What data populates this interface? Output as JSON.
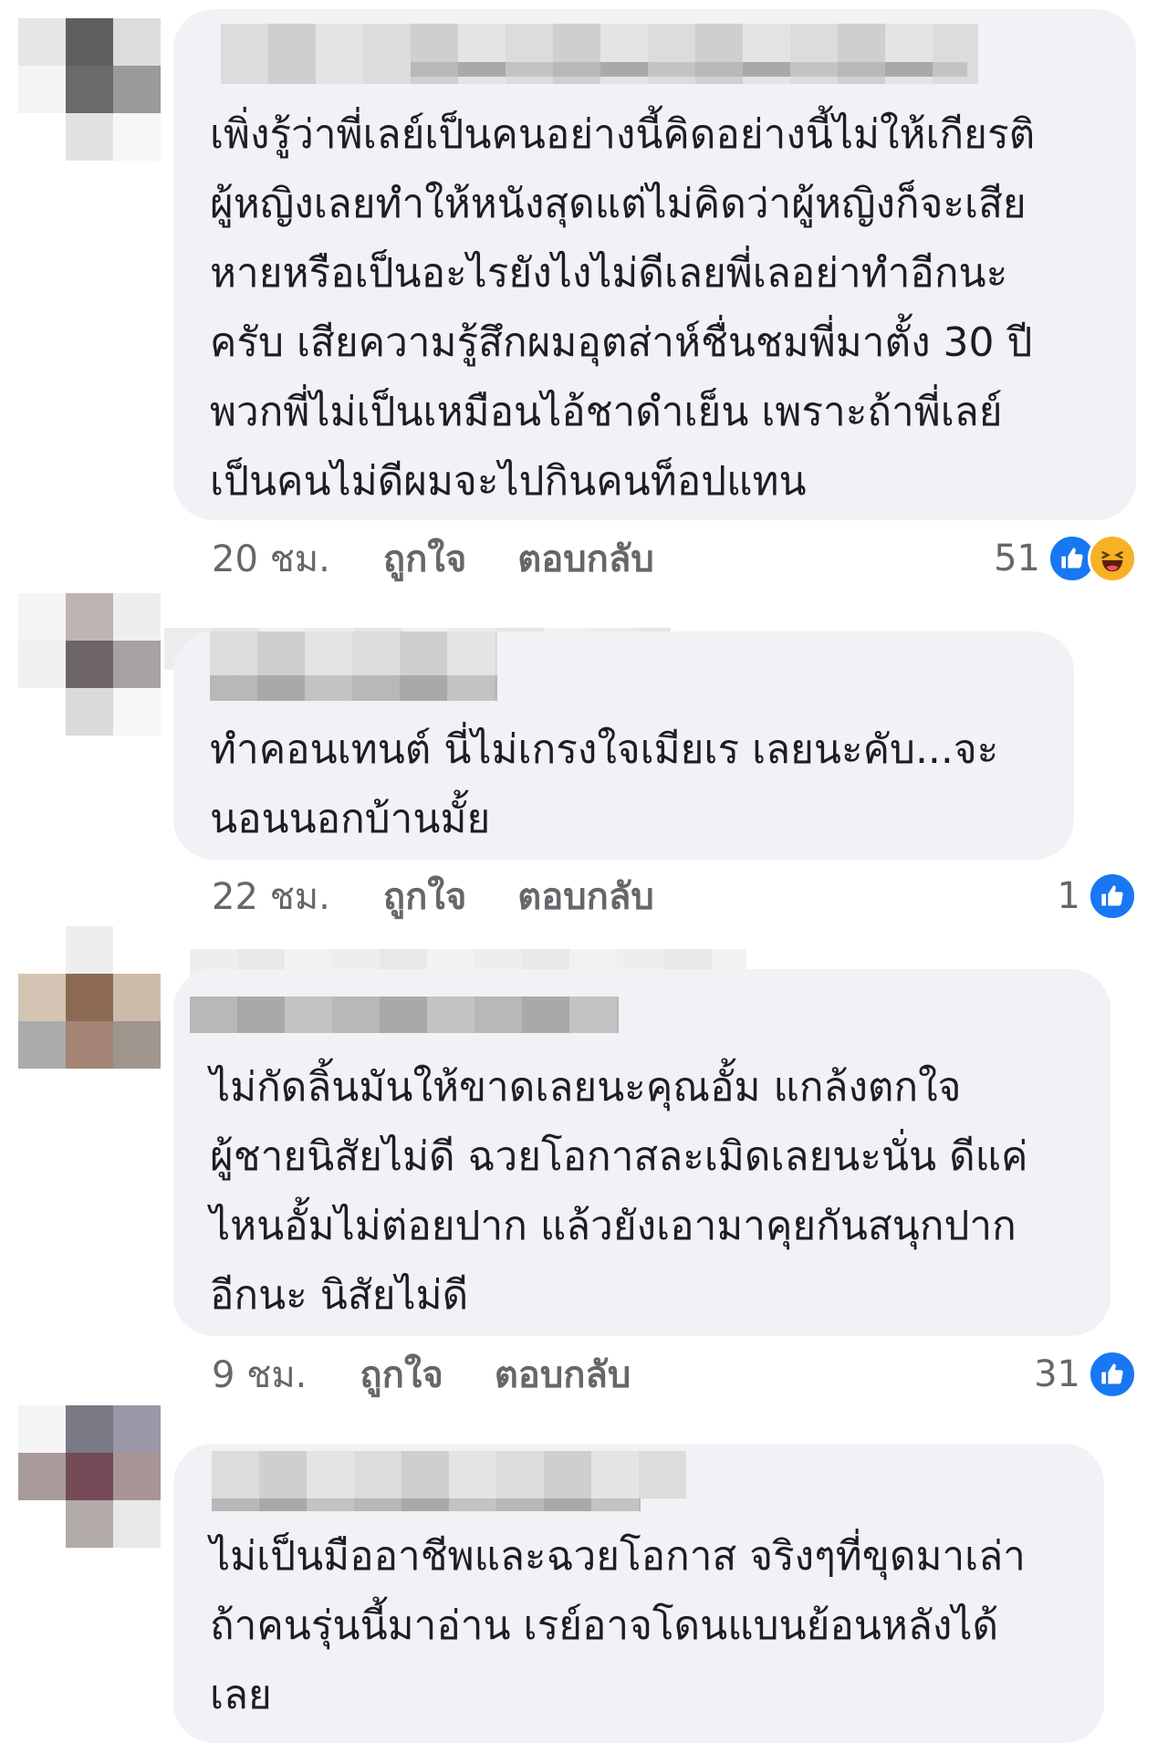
{
  "colors": {
    "bubble_bg": "#f0f2f5",
    "text": "#1c1e21",
    "meta": "#65676b",
    "like": "#1877f2",
    "haha": "#f7b125"
  },
  "comments": [
    {
      "text": "เพิ่งรู้ว่าพี่เลย์เป็นคนอย่างนี้คิดอย่างนี้ไม่ให้เกียรติ\nผู้หญิงเลยทำให้หนังสุดแต่ไม่คิดว่าผู้หญิงก็จะเสีย\nหายหรือเป็นอะไรยังไงไม่ดีเลยพี่เลอย่าทำอีกนะ\nครับ เสียความรู้สึกผมอุตส่าห์ชื่นชมพี่มาตั้ง 30 ปี\nพวกพี่ไม่เป็นเหมือนไอ้ชาดำเย็น เพราะถ้าพี่เลย์\nเป็นคนไม่ดีผมจะไปกินคนท็อปแทน",
      "time": "20 ชม.",
      "like_label": "ถูกใจ",
      "reply_label": "ตอบกลับ",
      "reaction_count": "51",
      "reactions": [
        "like-icon",
        "haha-icon"
      ]
    },
    {
      "text": "ทำคอนเทนต์ นี่ไม่เกรงใจเมียเร เลยนะคับ...จะ\nนอนนอกบ้านมั้ย",
      "time": "22 ชม.",
      "like_label": "ถูกใจ",
      "reply_label": "ตอบกลับ",
      "reaction_count": "1",
      "reactions": [
        "like-icon"
      ]
    },
    {
      "text": "ไม่กัดลิ้นมันให้ขาดเลยนะคุณอั้ม แกล้งตกใจ\nผู้ชายนิสัยไม่ดี ฉวยโอกาสละเมิดเลยนะนั่น ดีแค่\nไหนอั้มไม่ต่อยปาก แล้วยังเอามาคุยกันสนุกปาก\nอีกนะ นิสัยไม่ดี",
      "time": "9 ชม.",
      "like_label": "ถูกใจ",
      "reply_label": "ตอบกลับ",
      "reaction_count": "31",
      "reactions": [
        "like-icon"
      ]
    },
    {
      "text": "ไม่เป็นมืออาชีพและฉวยโอกาส จริงๆที่ขุดมาเล่า\nถ้าคนรุ่นนี้มาอ่าน เรย์อาจโดนแบนย้อนหลังได้\nเลย"
    }
  ]
}
